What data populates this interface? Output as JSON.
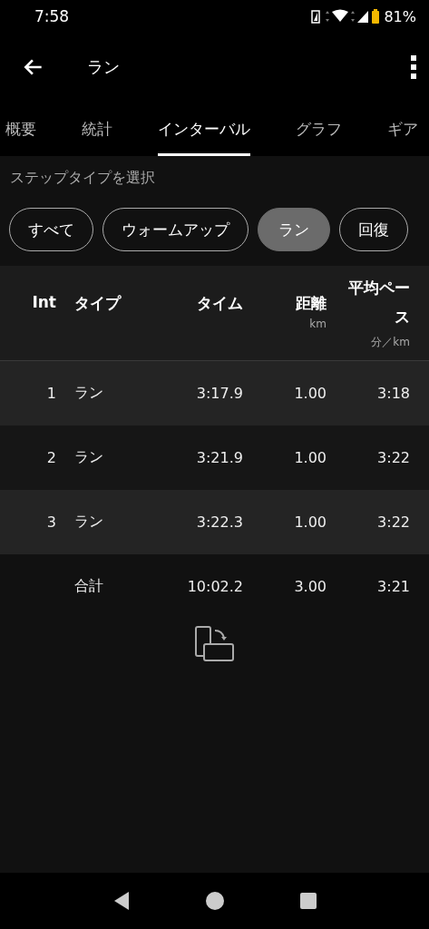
{
  "status_bar": {
    "time": "7:58",
    "battery": "81%"
  },
  "app_bar": {
    "title": "ラン"
  },
  "tabs": [
    {
      "label": "概要",
      "selected": false
    },
    {
      "label": "統計",
      "selected": false
    },
    {
      "label": "インターバル",
      "selected": true
    },
    {
      "label": "グラフ",
      "selected": false
    },
    {
      "label": "ギア",
      "selected": false
    }
  ],
  "filter": {
    "label": "ステップタイプを選択",
    "chips": [
      {
        "label": "すべて",
        "selected": false
      },
      {
        "label": "ウォームアップ",
        "selected": false
      },
      {
        "label": "ラン",
        "selected": true
      },
      {
        "label": "回復",
        "selected": false
      }
    ]
  },
  "table": {
    "columns": [
      {
        "title": "Int"
      },
      {
        "title": "タイプ"
      },
      {
        "title": "タイム"
      },
      {
        "title": "距離",
        "unit": "km"
      },
      {
        "title": "平均ペース",
        "unit": "分／km"
      }
    ],
    "rows": [
      [
        "1",
        "ラン",
        "3:17.9",
        "1.00",
        "3:18"
      ],
      [
        "2",
        "ラン",
        "3:21.9",
        "1.00",
        "3:22"
      ],
      [
        "3",
        "ラン",
        "3:22.3",
        "1.00",
        "3:22"
      ]
    ],
    "total": {
      "label": "合計",
      "time": "10:02.2",
      "distance": "3.00",
      "pace": "3:21"
    }
  }
}
